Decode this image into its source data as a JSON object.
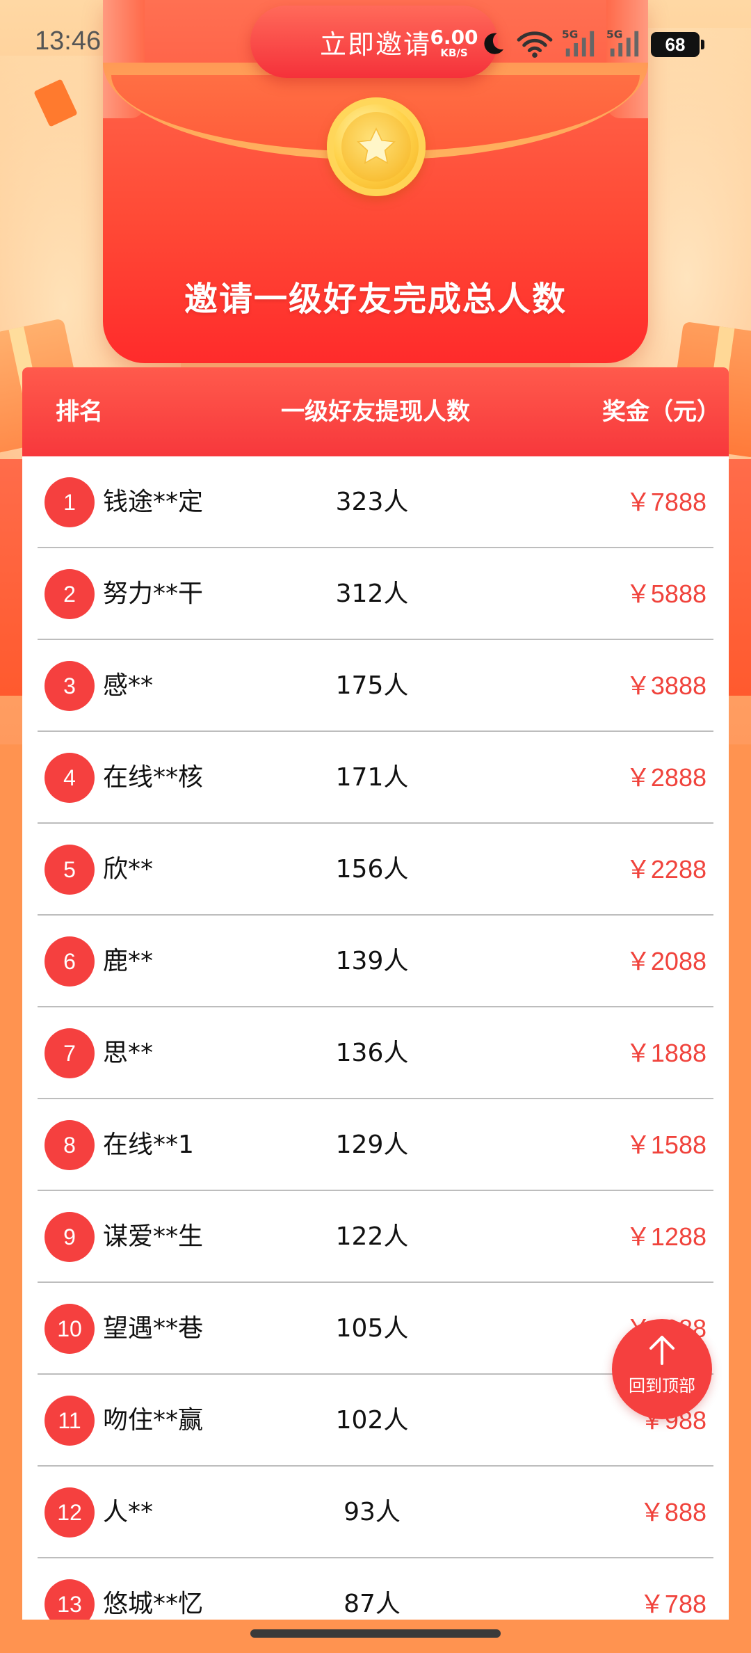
{
  "status_bar": {
    "time": "13:46",
    "speed_value": "6.00",
    "speed_unit": "KB/S",
    "battery": "68"
  },
  "banner": {
    "invite_button": "立即邀请",
    "headline": "邀请一级好友完成总人数"
  },
  "table": {
    "headers": {
      "rank": "排名",
      "count": "一级好友提现人数",
      "prize": "奖金（元）"
    },
    "rows": [
      {
        "rank": "1",
        "name": "钱途**定",
        "count": "323人",
        "prize": "￥7888"
      },
      {
        "rank": "2",
        "name": "努力**干",
        "count": "312人",
        "prize": "￥5888"
      },
      {
        "rank": "3",
        "name": "感**",
        "count": "175人",
        "prize": "￥3888"
      },
      {
        "rank": "4",
        "name": "在线**核",
        "count": "171人",
        "prize": "￥2888"
      },
      {
        "rank": "5",
        "name": "欣**",
        "count": "156人",
        "prize": "￥2288"
      },
      {
        "rank": "6",
        "name": "鹿**",
        "count": "139人",
        "prize": "￥2088"
      },
      {
        "rank": "7",
        "name": "思**",
        "count": "136人",
        "prize": "￥1888"
      },
      {
        "rank": "8",
        "name": "在线**1",
        "count": "129人",
        "prize": "￥1588"
      },
      {
        "rank": "9",
        "name": "谋爱**生",
        "count": "122人",
        "prize": "￥1288"
      },
      {
        "rank": "10",
        "name": "望遇**巷",
        "count": "105人",
        "prize": "￥1088"
      },
      {
        "rank": "11",
        "name": "吻住**赢",
        "count": "102人",
        "prize": "￥988"
      },
      {
        "rank": "12",
        "name": "人**",
        "count": "93人",
        "prize": "￥888"
      },
      {
        "rank": "13",
        "name": "悠城**忆",
        "count": "87人",
        "prize": "￥788"
      }
    ]
  },
  "back_to_top": {
    "label": "回到顶部"
  },
  "colors": {
    "accent_red": "#f5403f",
    "prize_red": "#f0433c",
    "page_orange": "#ff9350"
  }
}
